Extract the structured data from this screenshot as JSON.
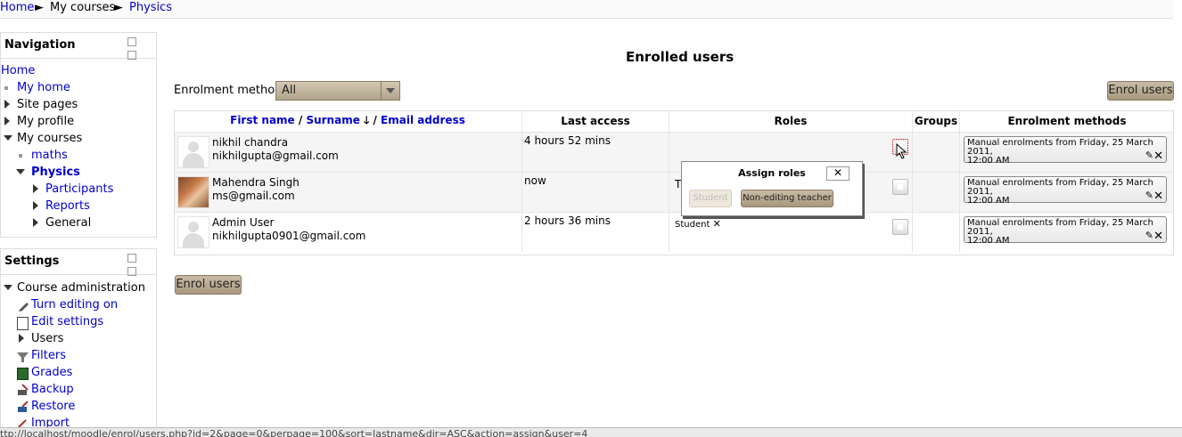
{
  "breadcrumb": {
    "home": "Home",
    "sep1": "►",
    "courses": "My courses",
    "sep2": "►",
    "current": "Physics"
  },
  "navigation": {
    "title": "Navigation",
    "home": "Home",
    "my_home": "My home",
    "site_pages": "Site pages",
    "my_profile": "My profile",
    "my_courses": "My courses",
    "maths": "maths",
    "physics": "Physics",
    "participants": "Participants",
    "reports": "Reports",
    "general": "General"
  },
  "settings": {
    "title": "Settings",
    "course_admin": "Course administration",
    "turn_editing_on": "Turn editing on",
    "edit_settings": "Edit settings",
    "users": "Users",
    "filters": "Filters",
    "grades": "Grades",
    "backup": "Backup",
    "restore": "Restore",
    "import": "Import"
  },
  "main": {
    "title": "Enrolled users",
    "enrol_methods_label": "Enrolment methods",
    "enrol_methods_value": "All",
    "enrol_users_button": "Enrol users"
  },
  "table": {
    "headers": {
      "first_name": "First name",
      "slash1": " / ",
      "surname": "Surname",
      "slash2": " / ",
      "email": "Email address",
      "last_access": "Last access",
      "roles": "Roles",
      "groups": "Groups",
      "methods": "Enrolment methods"
    },
    "rows": [
      {
        "name": "nikhil chandra",
        "email": "nikhilgupta@gmail.com",
        "last_access": "4 hours 52 mins",
        "role": "",
        "method_line1": "Manual enrolments from Friday, 25 March 2011,",
        "method_line2": "12:00 AM"
      },
      {
        "name": "Mahendra Singh",
        "email": "ms@gmail.com",
        "last_access": "now",
        "role": "T",
        "method_line1": "Manual enrolments from Friday, 25 March 2011,",
        "method_line2": "12:00 AM"
      },
      {
        "name": "Admin User",
        "email": "nikhilgupta0901@gmail.com",
        "last_access": "2 hours 36 mins",
        "role": "Student",
        "method_line1": "Manual enrolments from Friday, 25 March 2011,",
        "method_line2": "12:00 AM"
      }
    ]
  },
  "popup": {
    "title": "Assign roles",
    "close": "✕",
    "student": "Student",
    "non_editing_teacher": "Non-editing teacher"
  },
  "status_bar": "ttp://localhost/moodle/enrol/users.php?id=2&page=0&perpage=100&sort=lastname&dir=ASC&action=assign&user=4"
}
